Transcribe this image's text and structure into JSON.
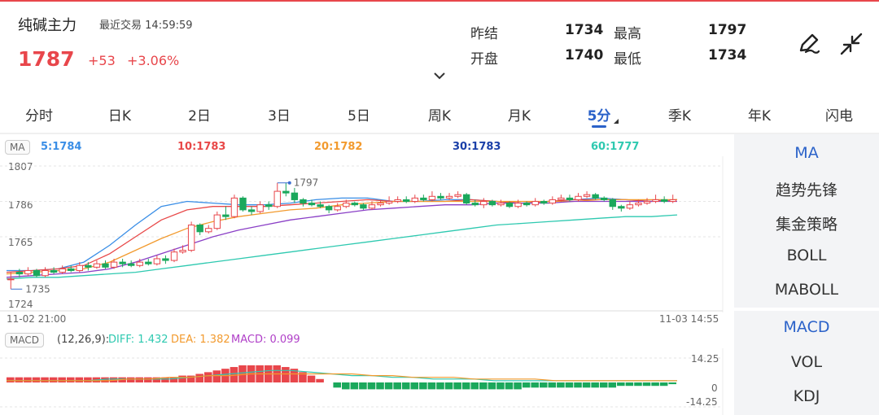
{
  "header": {
    "name": "纯碱主力",
    "trade_label": "最近交易",
    "trade_time": "14:59:59",
    "price": "1787",
    "change": "+53",
    "change_pct": "+3.06%",
    "stats": {
      "prev_settle_label": "昨结",
      "prev_settle": "1734",
      "high_label": "最高",
      "high": "1797",
      "open_label": "开盘",
      "open": "1740",
      "low_label": "最低",
      "low": "1734"
    },
    "icons": [
      "edit-pen-icon",
      "collapse-arrows-icon",
      "chevron-down-icon"
    ]
  },
  "tabs": [
    "分时",
    "日K",
    "2日",
    "3日",
    "5日",
    "周K",
    "月K",
    "5分",
    "季K",
    "年K",
    "闪电"
  ],
  "active_tab": "5分",
  "ma_bar": {
    "badge": "MA",
    "items": [
      {
        "label": "5:1784",
        "color": "#3a8ee6"
      },
      {
        "label": "10:1783",
        "color": "#e84848"
      },
      {
        "label": "20:1782",
        "color": "#f29a2e"
      },
      {
        "label": "30:1783",
        "color": "#1a3fa8"
      },
      {
        "label": "60:1777",
        "color": "#2ec9b0"
      }
    ]
  },
  "price_axis": {
    "top": "1807",
    "upper": "1786",
    "lower": "1765",
    "bottom": "1724"
  },
  "time_axis": {
    "start": "11-02 21:00",
    "end": "11-03 14:55"
  },
  "annotations": {
    "high": "1797",
    "low": "1735"
  },
  "macd_bar": {
    "badge": "MACD",
    "params": "(12,26,9):",
    "diff": "DIFF: 1.432",
    "dea": "DEA: 1.382",
    "macd": "MACD: 0.099",
    "diff_color": "#2ec9b0",
    "dea_color": "#f29a2e",
    "macd_color": "#b040c8"
  },
  "macd_axis": {
    "top": "14.25",
    "mid": "0",
    "bottom": "-14.25"
  },
  "side_panel": {
    "group1": [
      "MA",
      "趋势先锋",
      "集金策略",
      "BOLL",
      "MABOLL"
    ],
    "group2": [
      "MACD",
      "VOL",
      "KDJ"
    ],
    "active": [
      "MA",
      "MACD"
    ]
  },
  "colors": {
    "up": "#e8464b",
    "down": "#1ba85c",
    "accent": "#2b62c9"
  },
  "chart_data": {
    "type": "candlestick",
    "yrange": [
      1724,
      1807
    ],
    "candles": [
      [
        1740,
        1740,
        1744,
        1734
      ],
      [
        1744,
        1743,
        1746,
        1741
      ],
      [
        1743,
        1745,
        1747,
        1742
      ],
      [
        1745,
        1742,
        1746,
        1741
      ],
      [
        1742,
        1745,
        1747,
        1741
      ],
      [
        1745,
        1744,
        1747,
        1743
      ],
      [
        1744,
        1746,
        1748,
        1743
      ],
      [
        1746,
        1745,
        1748,
        1744
      ],
      [
        1745,
        1748,
        1750,
        1744
      ],
      [
        1748,
        1747,
        1750,
        1745
      ],
      [
        1747,
        1749,
        1751,
        1746
      ],
      [
        1749,
        1747,
        1751,
        1746
      ],
      [
        1747,
        1750,
        1752,
        1746
      ],
      [
        1750,
        1749,
        1752,
        1747
      ],
      [
        1749,
        1748,
        1751,
        1747
      ],
      [
        1748,
        1750,
        1752,
        1747
      ],
      [
        1750,
        1749,
        1752,
        1748
      ],
      [
        1749,
        1752,
        1754,
        1748
      ],
      [
        1752,
        1751,
        1754,
        1749
      ],
      [
        1751,
        1756,
        1758,
        1750
      ],
      [
        1756,
        1757,
        1760,
        1755
      ],
      [
        1757,
        1772,
        1774,
        1756
      ],
      [
        1772,
        1768,
        1773,
        1766
      ],
      [
        1768,
        1770,
        1772,
        1767
      ],
      [
        1770,
        1778,
        1780,
        1769
      ],
      [
        1778,
        1777,
        1783,
        1775
      ],
      [
        1777,
        1788,
        1790,
        1776
      ],
      [
        1788,
        1781,
        1789,
        1780
      ],
      [
        1781,
        1780,
        1783,
        1778
      ],
      [
        1780,
        1784,
        1786,
        1779
      ],
      [
        1784,
        1783,
        1786,
        1781
      ],
      [
        1783,
        1792,
        1797,
        1782
      ],
      [
        1792,
        1791,
        1797,
        1789
      ],
      [
        1791,
        1787,
        1794,
        1785
      ],
      [
        1787,
        1785,
        1788,
        1783
      ],
      [
        1785,
        1784,
        1787,
        1783
      ],
      [
        1784,
        1783,
        1786,
        1782
      ],
      [
        1783,
        1781,
        1784,
        1779
      ],
      [
        1781,
        1783,
        1785,
        1780
      ],
      [
        1783,
        1785,
        1787,
        1782
      ],
      [
        1785,
        1784,
        1786,
        1783
      ],
      [
        1784,
        1782,
        1785,
        1781
      ],
      [
        1782,
        1784,
        1786,
        1781
      ],
      [
        1784,
        1785,
        1787,
        1783
      ],
      [
        1785,
        1786,
        1789,
        1784
      ],
      [
        1786,
        1787,
        1789,
        1785
      ],
      [
        1787,
        1786,
        1789,
        1785
      ],
      [
        1786,
        1788,
        1790,
        1785
      ],
      [
        1788,
        1787,
        1790,
        1786
      ],
      [
        1787,
        1789,
        1792,
        1786
      ],
      [
        1789,
        1788,
        1791,
        1787
      ],
      [
        1788,
        1789,
        1791,
        1787
      ],
      [
        1789,
        1790,
        1792,
        1788
      ],
      [
        1790,
        1785,
        1791,
        1784
      ],
      [
        1785,
        1784,
        1787,
        1783
      ],
      [
        1784,
        1786,
        1788,
        1782
      ],
      [
        1786,
        1784,
        1787,
        1783
      ],
      [
        1784,
        1785,
        1787,
        1783
      ],
      [
        1785,
        1783,
        1786,
        1782
      ],
      [
        1783,
        1785,
        1787,
        1782
      ],
      [
        1785,
        1784,
        1786,
        1783
      ],
      [
        1784,
        1786,
        1788,
        1783
      ],
      [
        1786,
        1785,
        1787,
        1784
      ],
      [
        1785,
        1787,
        1789,
        1784
      ],
      [
        1787,
        1788,
        1790,
        1786
      ],
      [
        1788,
        1787,
        1790,
        1786
      ],
      [
        1787,
        1789,
        1791,
        1786
      ],
      [
        1789,
        1790,
        1792,
        1788
      ],
      [
        1790,
        1788,
        1791,
        1787
      ],
      [
        1788,
        1787,
        1789,
        1786
      ],
      [
        1787,
        1783,
        1788,
        1781
      ],
      [
        1783,
        1782,
        1784,
        1780
      ],
      [
        1782,
        1784,
        1786,
        1781
      ],
      [
        1784,
        1785,
        1787,
        1783
      ],
      [
        1785,
        1786,
        1788,
        1784
      ],
      [
        1786,
        1787,
        1790,
        1785
      ],
      [
        1787,
        1786,
        1789,
        1785
      ],
      [
        1786,
        1787,
        1790,
        1785
      ]
    ],
    "ma": {
      "ma5": {
        "color": "#3a8ee6",
        "values": [
          1745,
          1745,
          1746,
          1750,
          1760,
          1772,
          1783,
          1786,
          1785,
          1784,
          1784,
          1785,
          1787,
          1788,
          1788,
          1786,
          1786,
          1787,
          1787,
          1786,
          1785,
          1786,
          1787,
          1788,
          1787,
          1786,
          1787
        ]
      },
      "ma10": {
        "color": "#e84848",
        "values": [
          1744,
          1745,
          1746,
          1748,
          1755,
          1765,
          1775,
          1781,
          1783,
          1783,
          1783,
          1784,
          1785,
          1786,
          1787,
          1786,
          1786,
          1786,
          1787,
          1786,
          1785,
          1786,
          1787,
          1787,
          1787,
          1786,
          1787
        ]
      },
      "ma20": {
        "color": "#f29a2e",
        "values": [
          1743,
          1744,
          1745,
          1746,
          1750,
          1757,
          1764,
          1770,
          1774,
          1777,
          1779,
          1781,
          1782,
          1784,
          1785,
          1786,
          1786,
          1786,
          1786,
          1786,
          1786,
          1786,
          1786,
          1787,
          1787,
          1787,
          1787
        ]
      },
      "ma30": {
        "color": "#8a3fc6",
        "values": [
          1741,
          1742,
          1743,
          1744,
          1746,
          1750,
          1755,
          1760,
          1765,
          1769,
          1772,
          1775,
          1777,
          1779,
          1781,
          1782,
          1783,
          1784,
          1784,
          1785,
          1785,
          1785,
          1786,
          1786,
          1786,
          1786,
          1786
        ]
      },
      "ma60": {
        "color": "#2ec9b0",
        "values": [
          1740,
          1741,
          1741,
          1742,
          1743,
          1744,
          1746,
          1748,
          1750,
          1752,
          1754,
          1756,
          1758,
          1760,
          1762,
          1764,
          1766,
          1768,
          1770,
          1772,
          1773,
          1774,
          1775,
          1776,
          1777,
          1777,
          1778
        ]
      }
    },
    "macd": {
      "range": [
        -14.25,
        14.25
      ],
      "hist": [
        3,
        3,
        3,
        3,
        3,
        3,
        3,
        3,
        3,
        3,
        3,
        3,
        3,
        3,
        3,
        3,
        3,
        3,
        3,
        3,
        4,
        4,
        5,
        6,
        7,
        8,
        9,
        10,
        10,
        10,
        10,
        10,
        9,
        8,
        6,
        4,
        2,
        0,
        -3,
        -4,
        -4,
        -4,
        -4,
        -4,
        -4,
        -4,
        -4,
        -4,
        -4,
        -4,
        -4,
        -4,
        -4,
        -4,
        -4,
        -4,
        -4,
        -4,
        -4,
        -4,
        -3,
        -3,
        -3,
        -3,
        -3,
        -3,
        -3,
        -3,
        -3,
        -3,
        -3,
        -2,
        -2,
        -2,
        -2,
        -2,
        -2,
        -1
      ],
      "diff": [
        1,
        1,
        1,
        1,
        1,
        2,
        2,
        2,
        2,
        3,
        4,
        5,
        6,
        7,
        7,
        6,
        5,
        4,
        4,
        3,
        3,
        2,
        2,
        2,
        1,
        1,
        1,
        1,
        1,
        1,
        1,
        1,
        1,
        1
      ],
      "dea": [
        1,
        1,
        1,
        1,
        1,
        1,
        2,
        2,
        3,
        3,
        4,
        4,
        5,
        5,
        5,
        5,
        5,
        5,
        4,
        4,
        3,
        3,
        3,
        2,
        2,
        2,
        2,
        1,
        1,
        1,
        1,
        1,
        1,
        1
      ]
    }
  }
}
